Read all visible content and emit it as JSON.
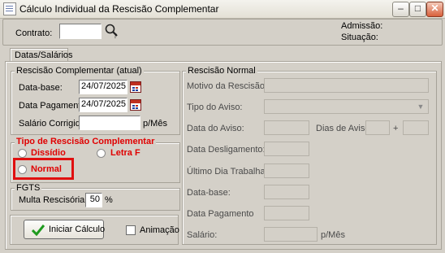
{
  "window": {
    "title": "Cálculo Individual da Rescisão Complementar",
    "minimize": "–",
    "maximize": "□",
    "close": "✕"
  },
  "header": {
    "contrato_label": "Contrato:",
    "contrato_value": "",
    "admissao_label": "Admissão:",
    "situacao_label": "Situação:"
  },
  "tabs": [
    {
      "label": "Datas/Salários"
    }
  ],
  "rescisao_atual": {
    "title": "Rescisão Complementar (atual)",
    "database_label": "Data-base:",
    "database_value": "24/07/2025",
    "datapag_label": "Data Pagamento:",
    "datapag_value": "24/07/2025",
    "salario_label": "Salário Corrigido:",
    "salario_value": "",
    "salario_unit": "p/Mês"
  },
  "tipo_rescisao": {
    "title": "Tipo de Rescisão Complementar",
    "options": [
      {
        "label": "Dissídio",
        "selected": false
      },
      {
        "label": "Letra F",
        "selected": false
      },
      {
        "label": "Normal",
        "selected": false
      }
    ]
  },
  "fgts": {
    "title": "FGTS",
    "multa_label": "Multa Rescisória:",
    "multa_value": "50",
    "multa_unit": "%"
  },
  "actions": {
    "calc_label": "Iniciar Cálculo",
    "animacao_label": "Animação",
    "animacao_checked": false
  },
  "rescisao_normal": {
    "title": "Rescisão Normal",
    "motivo_label": "Motivo da Rescisão:",
    "tipo_aviso_label": "Tipo do Aviso:",
    "tipo_aviso_value": "",
    "data_aviso_label": "Data do Aviso:",
    "dias_aviso_label": "Dias de Aviso:",
    "dias_plus": "+",
    "desligamento_label": "Data Desligamento:",
    "ultimo_dia_label": "Último Dia Trabalhado:",
    "database_label": "Data-base:",
    "datapag_label": "Data Pagamento",
    "salario_label": "Salário:",
    "salario_unit": "p/Mês"
  },
  "highlight_color": "#e01010"
}
